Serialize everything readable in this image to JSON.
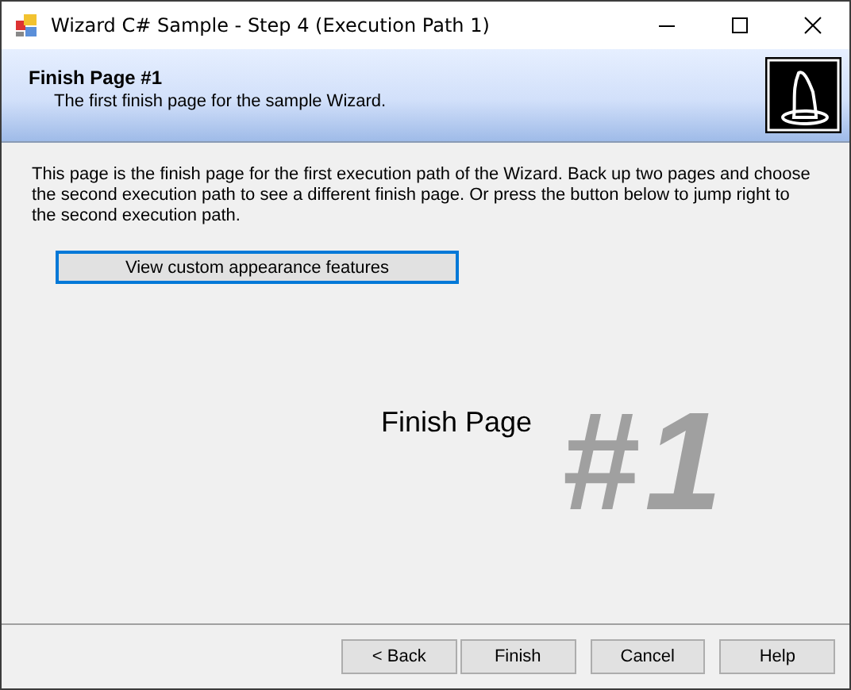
{
  "window": {
    "title": "Wizard C# Sample - Step 4 (Execution Path 1)"
  },
  "header": {
    "title": "Finish Page #1",
    "subtitle": "The first finish page for the sample Wizard."
  },
  "body": {
    "text": "This page is the finish page for the first execution path of the Wizard.  Back up two pages and choose the second execution path to see a different finish page.  Or press the button below to jump right to the second execution path.",
    "action_button": {
      "label": "View custom appearance features",
      "focused": true
    },
    "caption": "Finish Page",
    "big_number": "#1"
  },
  "buttons": [
    {
      "label": "< Back"
    },
    {
      "label": "Finish"
    },
    {
      "label": "Cancel"
    },
    {
      "label": "Help"
    }
  ]
}
